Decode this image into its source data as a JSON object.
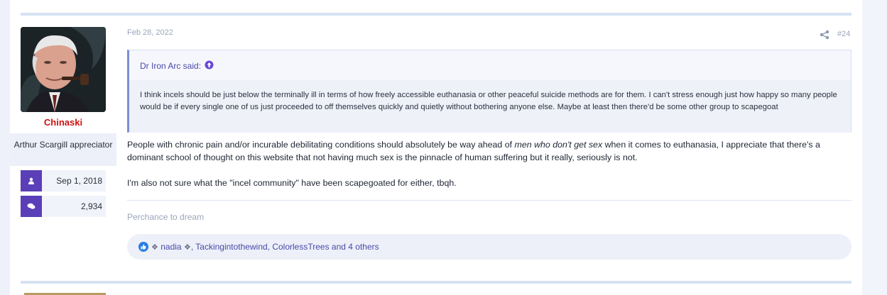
{
  "post": {
    "date": "Feb 28, 2022",
    "number": "#24",
    "share_icon": "share-icon"
  },
  "user": {
    "name": "Chinaski",
    "title": "Arthur Scargill appreciator",
    "joined": "Sep 1, 2018",
    "messages": "2,934",
    "name_color": "#d01010",
    "stat_icon_color": "#5b3fb8"
  },
  "quote": {
    "author_label": "Dr Iron Arc said:",
    "text": "I think incels should be just below the terminally ill in terms of how freely accessible euthanasia or other peaceful suicide methods are for them. I can't stress enough just how happy so many people would be if every single one of us just proceeded to off themselves quickly and quietly without bothering anyone else. Maybe at least then there'd be some other group to scapegoat"
  },
  "message": {
    "p1_before": "People with chronic pain and/or incurable debilitating conditions should absolutely be way ahead of ",
    "p1_em": "men who don't get sex",
    "p1_after": " when it comes to euthanasia, I appreciate that there's a dominant school of thought on this website that not having much sex is the pinnacle of human suffering but it really, seriously is not.",
    "p2": "I'm also not sure what the \"incel community\" have been scapegoated for either, tbqh."
  },
  "signature": "Perchance to dream",
  "reactions": {
    "deco_left": "❖",
    "name1": "nadia",
    "deco_right": "❖",
    "rest": ", Tackingintothewind, ColorlessTrees and 4 others"
  }
}
